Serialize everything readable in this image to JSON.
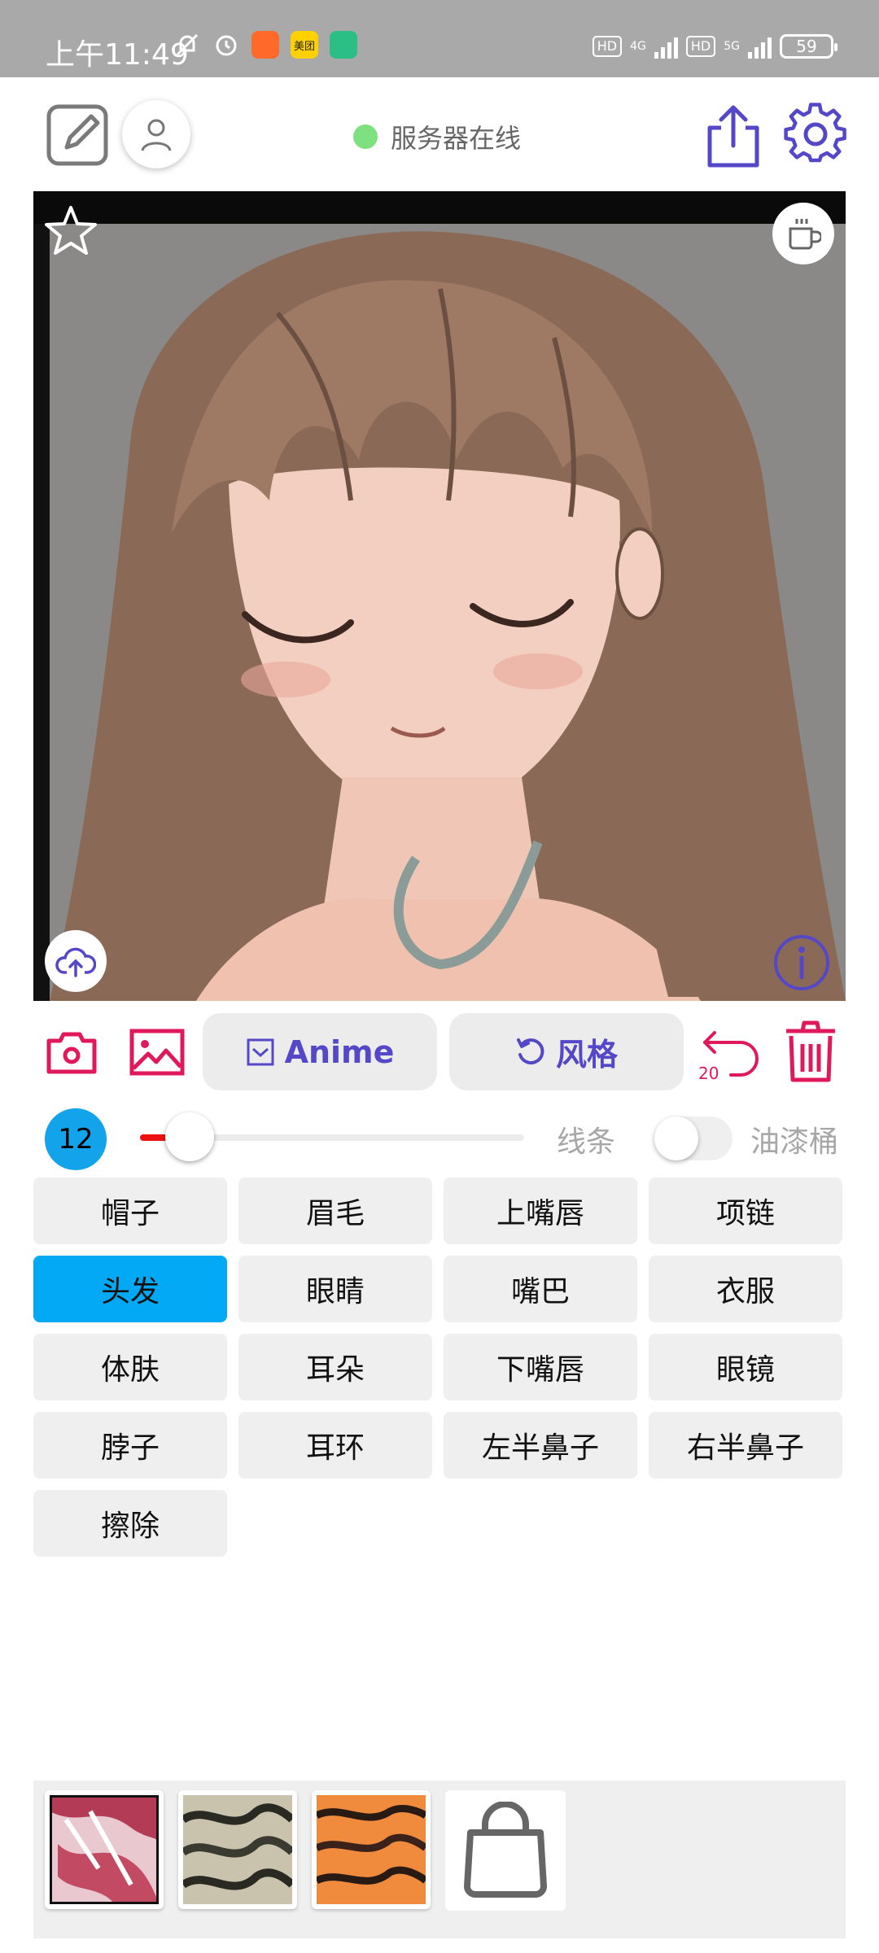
{
  "status_bar": {
    "time": "上午11:49",
    "app_badge_meituan": "美团",
    "network_1": "4G",
    "network_2": "5G",
    "hd_tag": "HD",
    "battery": "59"
  },
  "header": {
    "server_status": "服务器在线",
    "status_color": "#7ee07e"
  },
  "canvas": {
    "star_icon": "star-icon",
    "coffee_icon": "coffee-icon",
    "upload_icon": "cloud-upload-icon",
    "info_icon": "info-icon"
  },
  "toolbar": {
    "anime_label": "Anime",
    "style_label": "风格",
    "undo_count": "20"
  },
  "brush": {
    "size": "12",
    "slider_fraction": 0.13,
    "line_label": "线条",
    "bucket_label": "油漆桶",
    "bucket_on": false
  },
  "parts": [
    {
      "label": "帽子"
    },
    {
      "label": "眉毛"
    },
    {
      "label": "上嘴唇"
    },
    {
      "label": "项链"
    },
    {
      "label": "头发"
    },
    {
      "label": "眼睛"
    },
    {
      "label": "嘴巴"
    },
    {
      "label": "衣服"
    },
    {
      "label": "体肤"
    },
    {
      "label": "耳朵"
    },
    {
      "label": "下嘴唇"
    },
    {
      "label": "眼镜"
    },
    {
      "label": "脖子"
    },
    {
      "label": "耳环"
    },
    {
      "label": "左半鼻子"
    },
    {
      "label": "右半鼻子"
    },
    {
      "label": "擦除"
    }
  ],
  "selected_part": "头发",
  "accent_colors": {
    "primary_purple": "#5548c8",
    "pink_red": "#e0195a",
    "selection_blue": "#03a9f4",
    "slider_red": "#ee1111"
  }
}
